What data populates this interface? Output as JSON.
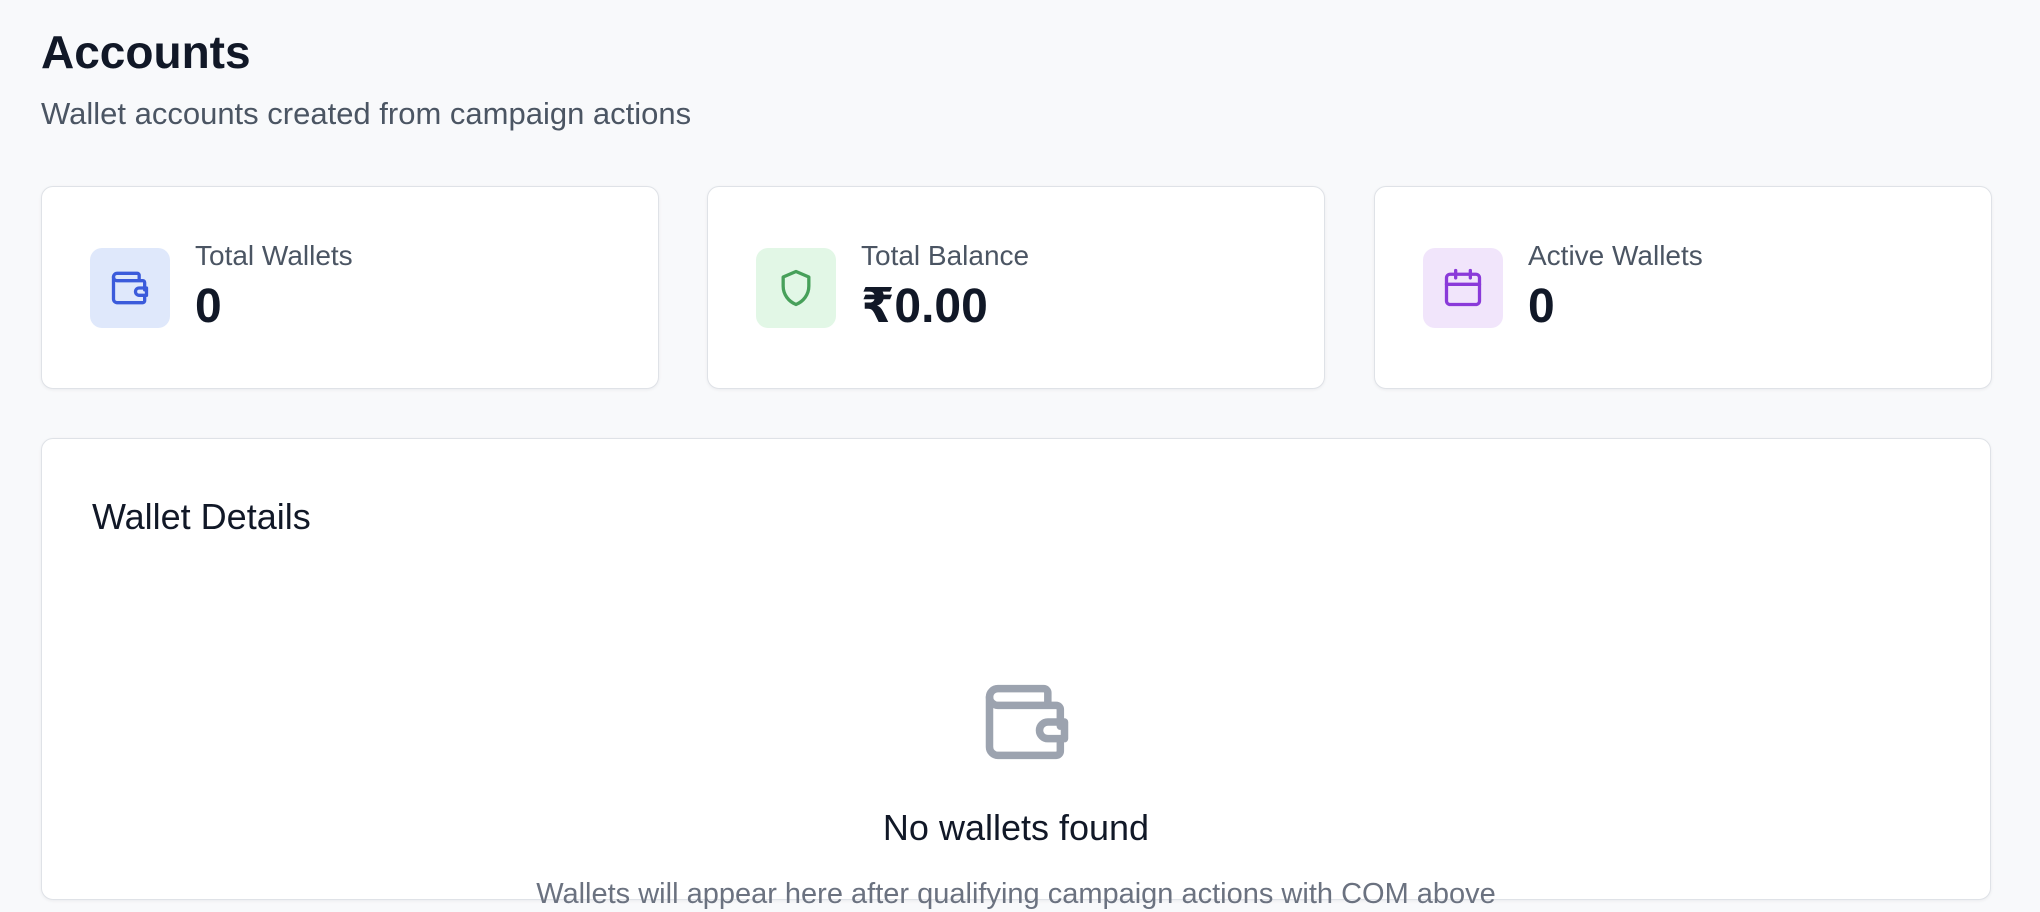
{
  "header": {
    "title": "Accounts",
    "subtitle": "Wallet accounts created from campaign actions"
  },
  "stats": [
    {
      "label": "Total Wallets",
      "value": "0",
      "icon": "wallet-icon",
      "icon_color": "#3b5bdb",
      "icon_bg": "#dfe8fb"
    },
    {
      "label": "Total Balance",
      "value": "₹0.00",
      "icon": "shield-icon",
      "icon_color": "#47a05a",
      "icon_bg": "#e2f7e6"
    },
    {
      "label": "Active Wallets",
      "value": "0",
      "icon": "calendar-icon",
      "icon_color": "#8a3ad9",
      "icon_bg": "#f1e5fb"
    }
  ],
  "details": {
    "title": "Wallet Details",
    "empty_icon": "wallet-icon",
    "empty_icon_color": "#9ca3af",
    "empty_title": "No wallets found",
    "empty_description": "Wallets will appear here after qualifying campaign actions with COM above"
  }
}
